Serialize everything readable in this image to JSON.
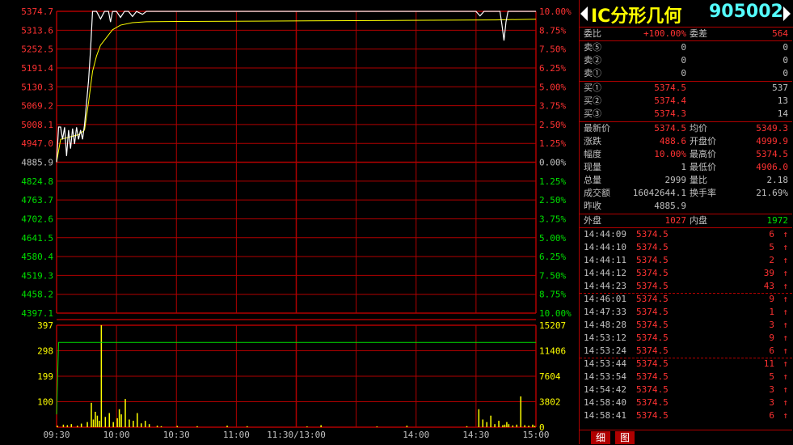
{
  "colors": {
    "up": "#ff3232",
    "down": "#00e000",
    "neutral": "#c0c0c0",
    "price_line": "#ffffff",
    "avg_line": "#ffff00",
    "grid": "#b00000",
    "volume": "#ffff00",
    "title_name": "#ffff00",
    "title_code": "#54fcfc"
  },
  "title": {
    "name": "IC分形几何",
    "code": "905002"
  },
  "order_book": {
    "ratio_label": "委比",
    "ratio_value": "+100.00%",
    "diff_label": "委差",
    "diff_value": "564",
    "asks": [
      {
        "label": "卖⑤",
        "price": "0",
        "vol": "0"
      },
      {
        "label": "卖②",
        "price": "0",
        "vol": "0"
      },
      {
        "label": "卖①",
        "price": "0",
        "vol": "0"
      }
    ],
    "bids": [
      {
        "label": "买①",
        "price": "5374.5",
        "vol": "537"
      },
      {
        "label": "买②",
        "price": "5374.4",
        "vol": "13"
      },
      {
        "label": "买③",
        "price": "5374.3",
        "vol": "14"
      }
    ]
  },
  "stats": [
    {
      "l1": "最新价",
      "v1": "5374.5",
      "c1": "up",
      "l2": "均价",
      "v2": "5349.3",
      "c2": "up"
    },
    {
      "l1": "涨跌",
      "v1": "488.6",
      "c1": "up",
      "l2": "开盘价",
      "v2": "4999.9",
      "c2": "up"
    },
    {
      "l1": "幅度",
      "v1": "10.00%",
      "c1": "up",
      "l2": "最高价",
      "v2": "5374.5",
      "c2": "up"
    },
    {
      "l1": "现量",
      "v1": "1",
      "c1": "neutral",
      "l2": "最低价",
      "v2": "4906.0",
      "c2": "up"
    },
    {
      "l1": "总量",
      "v1": "2999",
      "c1": "neutral",
      "l2": "量比",
      "v2": "2.18",
      "c2": "neutral"
    },
    {
      "l1": "成交额",
      "v1": "16042644.1",
      "c1": "neutral",
      "l2": "换手率",
      "v2": "21.69%",
      "c2": "neutral"
    },
    {
      "l1": "昨收",
      "v1": "4885.9",
      "c1": "neutral",
      "l2": "",
      "v2": "",
      "c2": "neutral"
    }
  ],
  "outer": {
    "label": "外盘",
    "value": "1027",
    "inner_label": "内盘",
    "inner_value": "1972"
  },
  "ticks": [
    {
      "time": "14:44:09",
      "price": "5374.5",
      "vol": "6",
      "arrow": "↑"
    },
    {
      "time": "14:44:10",
      "price": "5374.5",
      "vol": "5",
      "arrow": "↑"
    },
    {
      "time": "14:44:11",
      "price": "5374.5",
      "vol": "2",
      "arrow": "↑"
    },
    {
      "time": "14:44:12",
      "price": "5374.5",
      "vol": "39",
      "arrow": "↑"
    },
    {
      "time": "14:44:23",
      "price": "5374.5",
      "vol": "43",
      "arrow": "↑"
    },
    {
      "time": "14:46:01",
      "price": "5374.5",
      "vol": "9",
      "arrow": "↑"
    },
    {
      "time": "14:47:33",
      "price": "5374.5",
      "vol": "1",
      "arrow": "↑"
    },
    {
      "time": "14:48:28",
      "price": "5374.5",
      "vol": "3",
      "arrow": "↑"
    },
    {
      "time": "14:53:12",
      "price": "5374.5",
      "vol": "9",
      "arrow": "↑"
    },
    {
      "time": "14:53:24",
      "price": "5374.5",
      "vol": "6",
      "arrow": "↑"
    },
    {
      "time": "14:53:44",
      "price": "5374.5",
      "vol": "11",
      "arrow": "↑"
    },
    {
      "time": "14:53:54",
      "price": "5374.5",
      "vol": "5",
      "arrow": "↑"
    },
    {
      "time": "14:54:42",
      "price": "5374.5",
      "vol": "3",
      "arrow": "↑"
    },
    {
      "time": "14:58:40",
      "price": "5374.5",
      "vol": "3",
      "arrow": "↑"
    },
    {
      "time": "14:58:41",
      "price": "5374.5",
      "vol": "6",
      "arrow": "↑"
    }
  ],
  "tabs": [
    {
      "label": "细"
    },
    {
      "label": "图"
    }
  ],
  "chart_data": {
    "type": "line",
    "price_axis": {
      "ticks": [
        "5374.7",
        "5313.6",
        "5252.5",
        "5191.4",
        "5130.3",
        "5069.2",
        "5008.1",
        "4947.0",
        "4885.9",
        "4824.8",
        "4763.7",
        "4702.6",
        "4641.5",
        "4580.4",
        "4519.3",
        "4458.2",
        "4397.1"
      ],
      "ylim": [
        4397.1,
        5374.7
      ],
      "base": 4885.9
    },
    "pct_axis": {
      "ticks": [
        "10.00%",
        "8.75%",
        "7.50%",
        "6.25%",
        "5.00%",
        "3.75%",
        "2.50%",
        "1.25%",
        "0.00%",
        "1.25%",
        "2.50%",
        "3.75%",
        "5.00%",
        "6.25%",
        "7.50%",
        "8.75%",
        "10.00%"
      ]
    },
    "volume_axis": {
      "ticks_left": [
        "397",
        "298",
        "199",
        "100"
      ],
      "ticks_right": [
        "15207",
        "11406",
        "7604",
        "3802",
        "0"
      ],
      "ymax": 397
    },
    "x_labels": [
      "09:30",
      "10:00",
      "10:30",
      "11:00",
      "11:30/13:00",
      "14:00",
      "14:30",
      "15:00"
    ],
    "session_minutes": 240,
    "series": [
      {
        "values": [
          [
            0,
            4885.9
          ],
          [
            1,
            4999.9
          ],
          [
            2,
            4999.9
          ],
          [
            3,
            4960
          ],
          [
            4,
            4999
          ],
          [
            5,
            4906
          ],
          [
            6,
            4990
          ],
          [
            7,
            4930
          ],
          [
            8,
            4995
          ],
          [
            9,
            4945
          ],
          [
            10,
            4999
          ],
          [
            11,
            4960
          ],
          [
            12,
            4990
          ],
          [
            13,
            4960
          ],
          [
            14,
            5008
          ],
          [
            16,
            5150
          ],
          [
            17,
            5250
          ],
          [
            18,
            5374.5
          ],
          [
            20,
            5374.5
          ],
          [
            22,
            5350
          ],
          [
            24,
            5374.5
          ],
          [
            26,
            5374.5
          ],
          [
            27,
            5340
          ],
          [
            28,
            5374
          ],
          [
            30,
            5374.5
          ],
          [
            32,
            5355
          ],
          [
            34,
            5374.5
          ],
          [
            36,
            5374.5
          ],
          [
            38,
            5358
          ],
          [
            40,
            5374.5
          ],
          [
            43,
            5365
          ],
          [
            45,
            5374.5
          ],
          [
            210,
            5374.5
          ],
          [
            212,
            5360
          ],
          [
            214,
            5374.5
          ],
          [
            222,
            5374.5
          ],
          [
            223,
            5330
          ],
          [
            224,
            5280
          ],
          [
            225,
            5340
          ],
          [
            226,
            5374.5
          ],
          [
            240,
            5374.5
          ]
        ]
      },
      {
        "values": [
          [
            0,
            4885.9
          ],
          [
            2,
            4960
          ],
          [
            5,
            4965
          ],
          [
            8,
            4970
          ],
          [
            11,
            4975
          ],
          [
            14,
            4990
          ],
          [
            16,
            5080
          ],
          [
            18,
            5180
          ],
          [
            20,
            5230
          ],
          [
            22,
            5265
          ],
          [
            25,
            5290
          ],
          [
            28,
            5315
          ],
          [
            32,
            5330
          ],
          [
            38,
            5338
          ],
          [
            45,
            5341
          ],
          [
            60,
            5342
          ],
          [
            100,
            5343
          ],
          [
            160,
            5345
          ],
          [
            220,
            5347
          ],
          [
            240,
            5349.3
          ]
        ]
      }
    ],
    "volume": [
      [
        0,
        6
      ],
      [
        3,
        10
      ],
      [
        5,
        8
      ],
      [
        7,
        12
      ],
      [
        10,
        6
      ],
      [
        12,
        14
      ],
      [
        15,
        20
      ],
      [
        17,
        95
      ],
      [
        18,
        30
      ],
      [
        19,
        60
      ],
      [
        20,
        45
      ],
      [
        21,
        25
      ],
      [
        22,
        397
      ],
      [
        24,
        40
      ],
      [
        26,
        55
      ],
      [
        28,
        20
      ],
      [
        30,
        35
      ],
      [
        31,
        70
      ],
      [
        32,
        50
      ],
      [
        34,
        110
      ],
      [
        36,
        30
      ],
      [
        38,
        25
      ],
      [
        40,
        55
      ],
      [
        42,
        15
      ],
      [
        44,
        25
      ],
      [
        46,
        12
      ],
      [
        50,
        6
      ],
      [
        52,
        4
      ],
      [
        60,
        5
      ],
      [
        70,
        4
      ],
      [
        85,
        6
      ],
      [
        95,
        4
      ],
      [
        125,
        3
      ],
      [
        132,
        8
      ],
      [
        160,
        3
      ],
      [
        175,
        6
      ],
      [
        205,
        4
      ],
      [
        211,
        70
      ],
      [
        213,
        30
      ],
      [
        215,
        20
      ],
      [
        217,
        45
      ],
      [
        219,
        12
      ],
      [
        221,
        25
      ],
      [
        223,
        8
      ],
      [
        224,
        10
      ],
      [
        225,
        20
      ],
      [
        226,
        12
      ],
      [
        228,
        7
      ],
      [
        230,
        10
      ],
      [
        232,
        120
      ],
      [
        234,
        8
      ],
      [
        236,
        6
      ],
      [
        238,
        10
      ],
      [
        239,
        5
      ]
    ],
    "volume_avg": [
      [
        0,
        50
      ],
      [
        1,
        330
      ],
      [
        240,
        330
      ]
    ]
  }
}
